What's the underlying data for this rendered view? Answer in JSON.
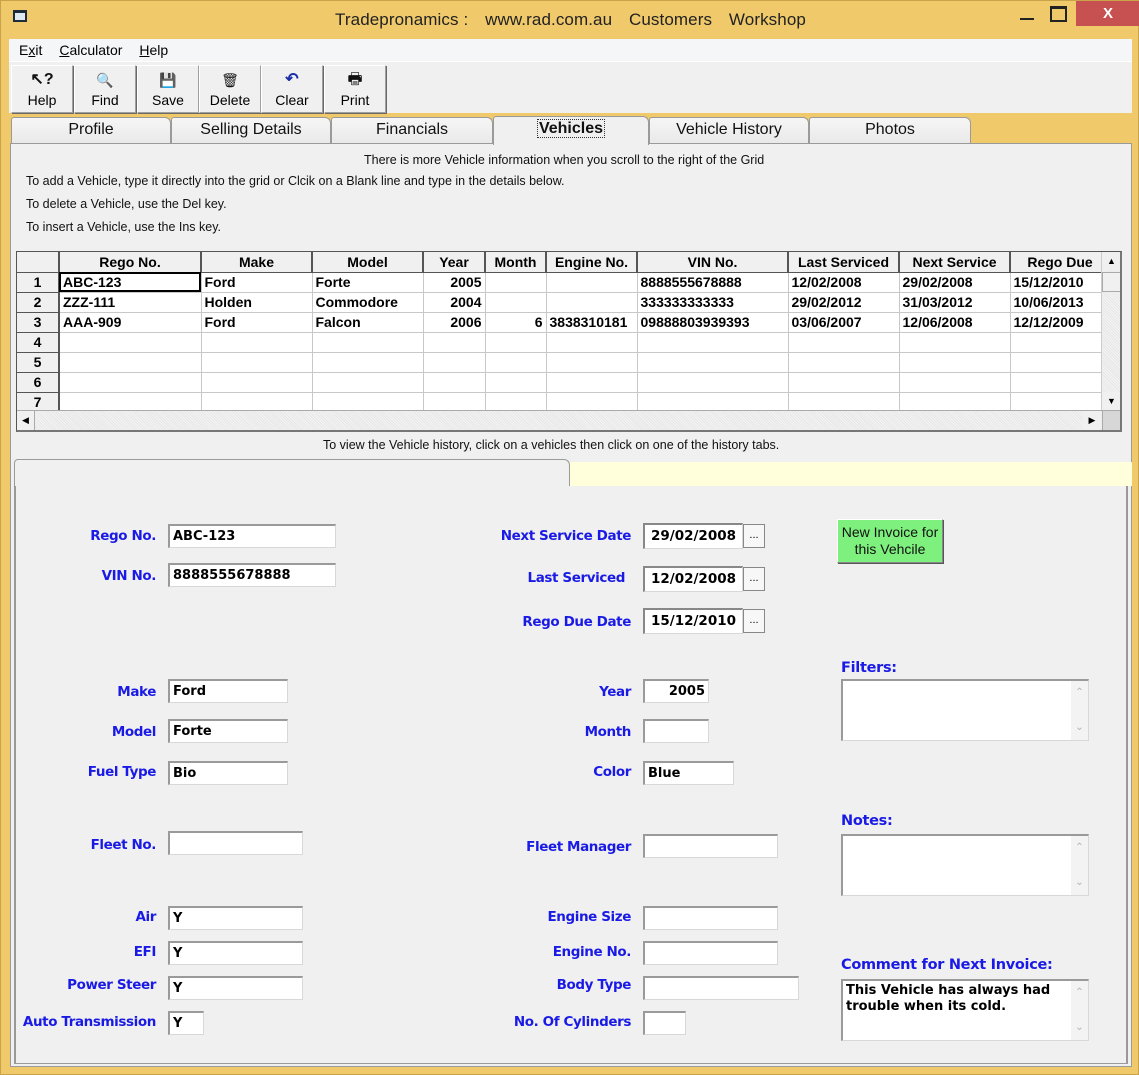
{
  "window": {
    "title_parts": [
      "Tradepronamics :",
      "www.rad.com.au",
      "Customers",
      "Workshop"
    ],
    "close_label": "X"
  },
  "menu": [
    {
      "label": "Exit",
      "accel_index": 1
    },
    {
      "label": "Calculator",
      "accel_index": 0
    },
    {
      "label": "Help",
      "accel_index": 0
    }
  ],
  "toolbar": [
    {
      "label": "Help",
      "icon": "help-pointer-icon",
      "glyph": "↖?"
    },
    {
      "label": "Find",
      "icon": "find-document-icon",
      "glyph": "🔍"
    },
    {
      "label": "Save",
      "icon": "floppy-disk-icon",
      "glyph": "💾"
    },
    {
      "label": "Delete",
      "icon": "recycle-bin-icon",
      "glyph": "🗑"
    },
    {
      "label": "Clear",
      "icon": "undo-arrow-icon",
      "glyph": "↶"
    },
    {
      "label": "Print",
      "icon": "printer-icon",
      "glyph": "🖶"
    }
  ],
  "tabs": [
    {
      "label": "Profile",
      "active": false
    },
    {
      "label": "Selling Details",
      "active": false
    },
    {
      "label": "Financials",
      "active": false
    },
    {
      "label": "Vehicles",
      "active": true
    },
    {
      "label": "Vehicle History",
      "active": false
    },
    {
      "label": "Photos",
      "active": false
    }
  ],
  "instructions": {
    "scroll_hint": "There is more Vehicle information when you scroll to the right of the Grid",
    "add": "To add a Vehicle, type it directly into the grid or Clcik on a Blank line and type in the details below.",
    "delete": "To delete a Vehicle, use the Del key.",
    "insert": "To insert a Vehicle, use the Ins key.",
    "history": "To view the Vehicle history, click on a vehicles then click on one of the history tabs."
  },
  "grid": {
    "columns": [
      "Rego No.",
      "Make",
      "Model",
      "Year",
      "Month",
      "Engine No.",
      "VIN No.",
      "Last Serviced",
      "Next Service",
      "Rego Due"
    ],
    "rows": [
      {
        "n": "1",
        "cells": [
          "ABC-123",
          "Ford",
          "Forte",
          "2005",
          "",
          "",
          "8888555678888",
          "12/02/2008",
          "29/02/2008",
          "15/12/2010"
        ]
      },
      {
        "n": "2",
        "cells": [
          "ZZZ-111",
          "Holden",
          "Commodore",
          "2004",
          "",
          "",
          "333333333333",
          "29/02/2012",
          "31/03/2012",
          "10/06/2013"
        ]
      },
      {
        "n": "3",
        "cells": [
          "AAA-909",
          "Ford",
          "Falcon",
          "2006",
          "6",
          "3838310181",
          "09888803939393",
          "03/06/2007",
          "12/06/2008",
          "12/12/2009"
        ]
      },
      {
        "n": "4",
        "cells": [
          "",
          "",
          "",
          "",
          "",
          "",
          "",
          "",
          "",
          ""
        ]
      },
      {
        "n": "5",
        "cells": [
          "",
          "",
          "",
          "",
          "",
          "",
          "",
          "",
          "",
          ""
        ]
      },
      {
        "n": "6",
        "cells": [
          "",
          "",
          "",
          "",
          "",
          "",
          "",
          "",
          "",
          ""
        ]
      },
      {
        "n": "7",
        "cells": [
          "",
          "",
          "",
          "",
          "",
          "",
          "",
          "",
          "",
          ""
        ]
      }
    ]
  },
  "details": {
    "rego_no": {
      "label": "Rego No.",
      "value": "ABC-123"
    },
    "vin_no": {
      "label": "VIN No.",
      "value": "8888555678888"
    },
    "next_service_date": {
      "label": "Next Service Date",
      "value": "29/02/2008"
    },
    "last_serviced": {
      "label": "Last Serviced",
      "value": "12/02/2008"
    },
    "rego_due_date": {
      "label": "Rego Due Date",
      "value": "15/12/2010"
    },
    "date_picker_label": "...",
    "new_invoice_label": "New Invoice for this Vehcile",
    "make": {
      "label": "Make",
      "value": "Ford"
    },
    "model": {
      "label": "Model",
      "value": "Forte"
    },
    "fuel_type": {
      "label": "Fuel Type",
      "value": "Bio"
    },
    "year": {
      "label": "Year",
      "value": "2005"
    },
    "month": {
      "label": "Month",
      "value": ""
    },
    "color": {
      "label": "Color",
      "value": "Blue"
    },
    "fleet_no": {
      "label": "Fleet No.",
      "value": ""
    },
    "fleet_manager": {
      "label": "Fleet Manager",
      "value": ""
    },
    "air": {
      "label": "Air",
      "value": "Y"
    },
    "efi": {
      "label": "EFI",
      "value": "Y"
    },
    "power_steer": {
      "label": "Power Steer",
      "value": "Y"
    },
    "auto_transmission": {
      "label": "Auto Transmission",
      "value": "Y"
    },
    "engine_size": {
      "label": "Engine Size",
      "value": ""
    },
    "engine_no": {
      "label": "Engine No.",
      "value": ""
    },
    "body_type": {
      "label": "Body Type",
      "value": ""
    },
    "no_of_cylinders": {
      "label": "No. Of Cylinders",
      "value": ""
    },
    "filters": {
      "label": "Filters:",
      "value": ""
    },
    "notes": {
      "label": "Notes:",
      "value": ""
    },
    "comment": {
      "label": "Comment for Next Invoice:",
      "value": "This Vehicle has always had\ntrouble when its cold."
    }
  },
  "colors": {
    "title_bar": "#f0c96b",
    "close_button": "#c75050",
    "label_blue": "#1a1ae6",
    "invoice_button": "#7ef07e",
    "sub_tab_strip": "#ffffdc"
  }
}
